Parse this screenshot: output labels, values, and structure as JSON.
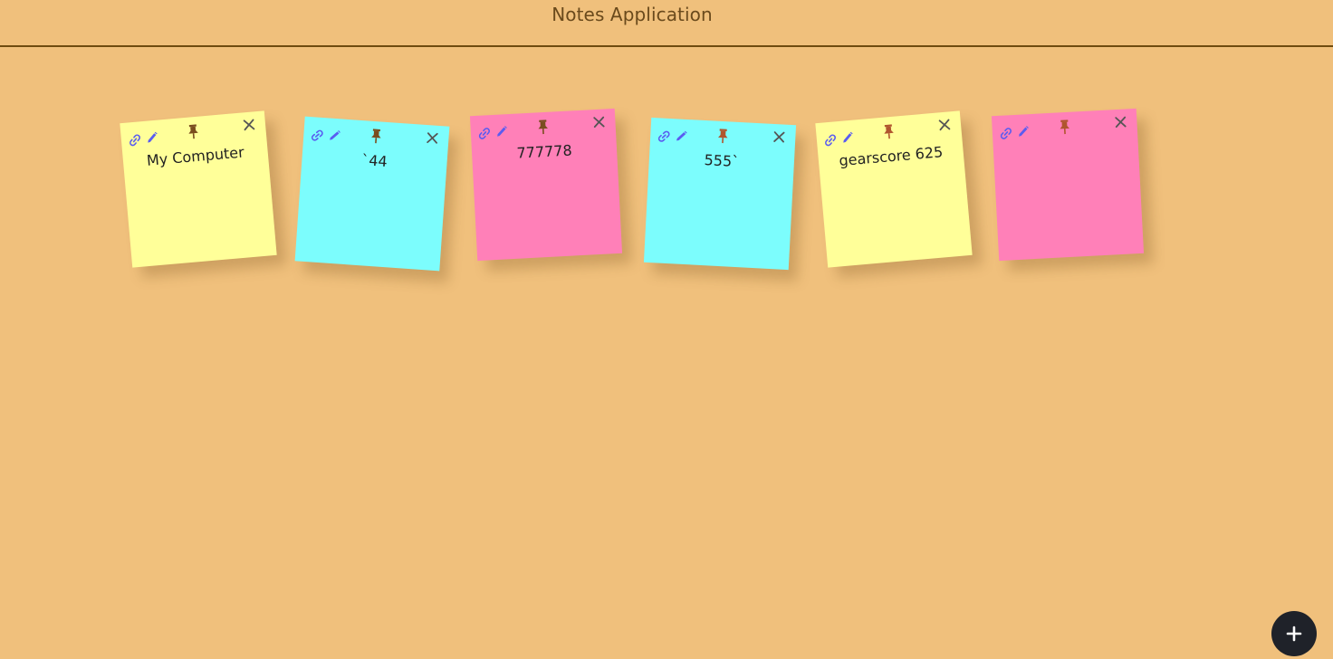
{
  "header": {
    "title": "Notes Application"
  },
  "colors": {
    "background": "#f0c07c",
    "yellow": "#ffff99",
    "cyan": "#7cfdfd",
    "pink": "#ff80b8",
    "icon_accent": "#5a5cf0",
    "pin": "#7a4d1e",
    "add_button": "#1f2229"
  },
  "notes": [
    {
      "text": "My Computer",
      "color": "yellow"
    },
    {
      "text": "`44",
      "color": "cyan"
    },
    {
      "text": "777778",
      "color": "pink"
    },
    {
      "text": "555`",
      "color": "cyan"
    },
    {
      "text": "gearscore 625",
      "color": "yellow"
    },
    {
      "text": "",
      "color": "pink"
    }
  ],
  "icons": {
    "link": "link-icon",
    "edit": "pencil-icon",
    "pin": "pin-icon",
    "close": "close-icon",
    "add": "plus-icon"
  }
}
